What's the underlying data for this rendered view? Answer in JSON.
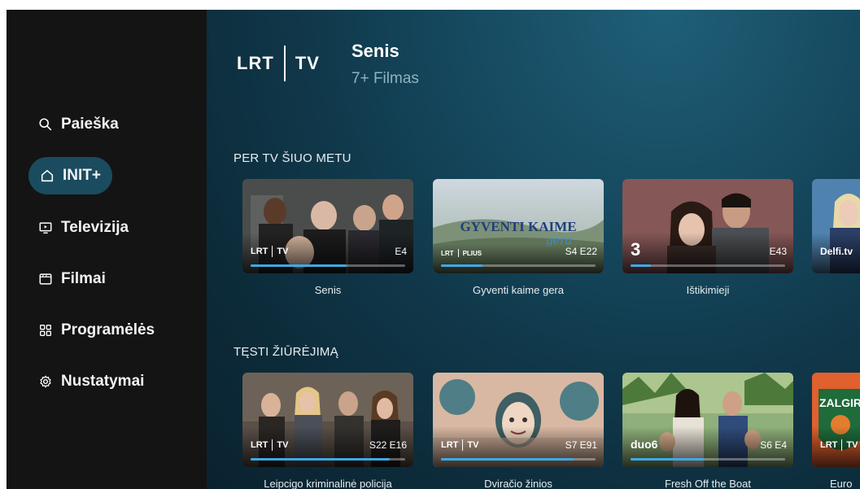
{
  "sidebar": {
    "items": [
      {
        "label": "Paieška",
        "icon": "search-icon"
      },
      {
        "label": "INIT+",
        "icon": "home-icon",
        "active": true
      },
      {
        "label": "Televizija",
        "icon": "tv-icon"
      },
      {
        "label": "Filmai",
        "icon": "film-icon"
      },
      {
        "label": "Programėlės",
        "icon": "apps-grid-icon"
      },
      {
        "label": "Nustatymai",
        "icon": "gear-icon"
      }
    ]
  },
  "header": {
    "logo_left": "LRT",
    "logo_right": "TV",
    "title": "Senis",
    "subtitle": "7+ Filmas"
  },
  "rows": [
    {
      "title": "PER TV ŠIUO METU",
      "cards": [
        {
          "label": "Senis",
          "badge_left": "LRT",
          "badge_right": "TV",
          "episode": "E4",
          "progress": 0.62
        },
        {
          "label": "Gyventi kaime gera",
          "badge_left": "LRT",
          "badge_right": "PLIUS",
          "episode": "S4 E22",
          "progress": 0.27,
          "art_title": "GYVENTI KAIME",
          "art_sub": "gera"
        },
        {
          "label": "Ištikimieji",
          "badge_left": "3",
          "badge_right": "",
          "episode": "E43",
          "progress": 0.13
        },
        {
          "label": "",
          "badge_left": "Delfi.tv",
          "badge_right": "",
          "episode": "",
          "progress": 0.0
        }
      ]
    },
    {
      "title": "TĘSTI ŽIŪRĖJIMĄ",
      "cards": [
        {
          "label": "Leipcigo kriminalinė policija",
          "badge_left": "LRT",
          "badge_right": "TV",
          "episode": "S22 E16",
          "progress": 0.9
        },
        {
          "label": "Dviračio žinios",
          "badge_left": "LRT",
          "badge_right": "TV",
          "episode": "S7 E91",
          "progress": 0.86
        },
        {
          "label": "Fresh Off the Boat",
          "badge_left": "duo6",
          "badge_right": "",
          "episode": "S6 E4",
          "progress": 0.48
        },
        {
          "label": "Euro",
          "badge_left": "LRT",
          "badge_right": "TV",
          "episode": "",
          "progress": 0.0,
          "art_title": "ZALGIR"
        }
      ]
    }
  ],
  "colors": {
    "sidebar_bg": "#141414",
    "active_pill": "#1b4b5f",
    "progress": "#3fa9e6",
    "main_bg": "#10384a"
  }
}
